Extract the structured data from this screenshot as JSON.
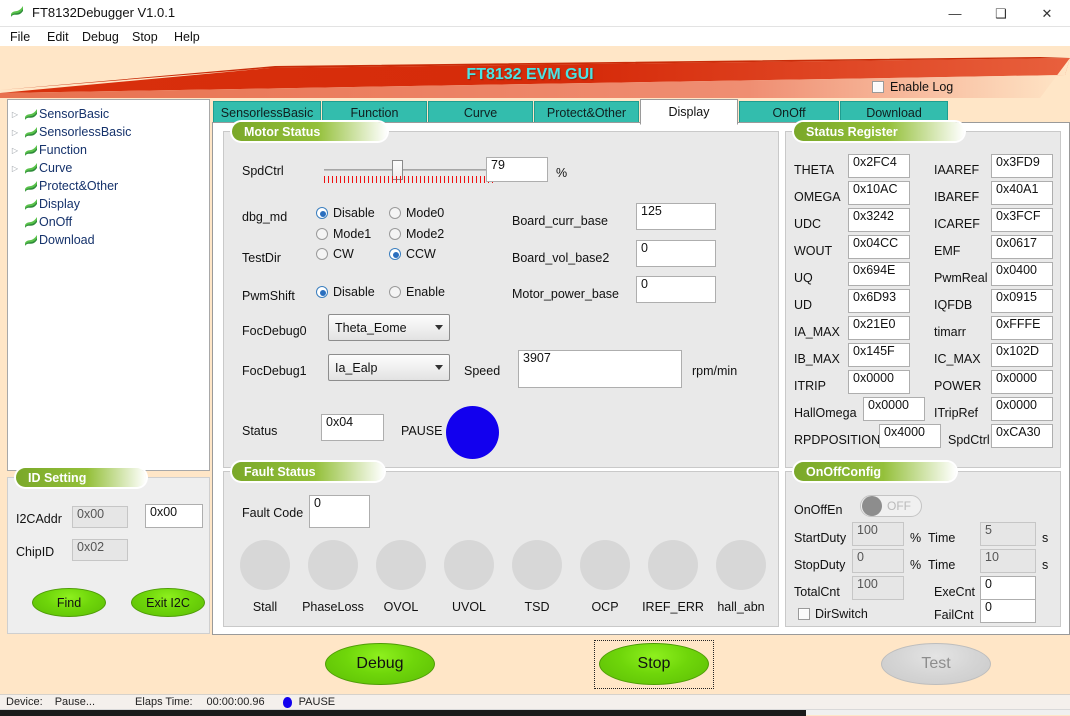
{
  "window": {
    "title": "FT8132Debugger V1.0.1",
    "app_icon": "flag-icon",
    "minimize": "—",
    "maximize": "❑",
    "close": "✕"
  },
  "menu": {
    "items": [
      {
        "label": "File"
      },
      {
        "label": "Edit"
      },
      {
        "label": "Debug"
      },
      {
        "label": "Stop"
      },
      {
        "label": "Help"
      }
    ]
  },
  "banner": {
    "title": "FT8132 EVM GUI",
    "enable_log_label": "Enable Log",
    "enable_log_checked": false,
    "shape_color": "#d62b0a",
    "title_color": "#4ae4e4",
    "background": "#ffe6c7"
  },
  "tree": {
    "items": [
      {
        "label": "SensorBasic",
        "expandable": true,
        "icon": "flag-icon"
      },
      {
        "label": "SensorlessBasic",
        "expandable": true,
        "icon": "flag-icon"
      },
      {
        "label": "Function",
        "expandable": true,
        "icon": "flag-icon"
      },
      {
        "label": "Curve",
        "expandable": true,
        "icon": "flag-icon"
      },
      {
        "label": "Protect&Other",
        "expandable": false,
        "icon": "flag-icon"
      },
      {
        "label": "Display",
        "expandable": false,
        "icon": "flag-icon"
      },
      {
        "label": "OnOff",
        "expandable": false,
        "icon": "flag-icon"
      },
      {
        "label": "Download",
        "expandable": false,
        "icon": "flag-icon"
      }
    ]
  },
  "id_setting": {
    "title": "ID Setting",
    "i2caddr_label": "I2CAddr",
    "i2caddr_value": "0x00",
    "i2caddr_input_value": "0x00",
    "chipid_label": "ChipID",
    "chipid_value": "0x02",
    "find_button": "Find",
    "exit_button": "Exit I2C"
  },
  "tabs": [
    {
      "label": "SensorlessBasic",
      "active": false
    },
    {
      "label": "Function",
      "active": false
    },
    {
      "label": "Curve",
      "active": false
    },
    {
      "label": "Protect&Other",
      "active": false
    },
    {
      "label": "Display",
      "active": true
    },
    {
      "label": "OnOff",
      "active": false
    },
    {
      "label": "Download",
      "active": false
    }
  ],
  "motor_status": {
    "title": "Motor Status",
    "spdctrl_label": "SpdCtrl",
    "spdctrl_value": "79",
    "spdctrl_unit": "%",
    "spdctrl_percent": 79,
    "dbg_md_label": "dbg_md",
    "dbg_md_options": [
      {
        "label": "Disable",
        "selected": true
      },
      {
        "label": "Mode0",
        "selected": false
      },
      {
        "label": "Mode1",
        "selected": false
      },
      {
        "label": "Mode2",
        "selected": false
      }
    ],
    "testdir_label": "TestDir",
    "testdir_options": [
      {
        "label": "CW",
        "selected": false
      },
      {
        "label": "CCW",
        "selected": true
      }
    ],
    "pwmshift_label": "PwmShift",
    "pwmshift_options": [
      {
        "label": "Disable",
        "selected": true
      },
      {
        "label": "Enable",
        "selected": false
      }
    ],
    "board_curr_base_label": "Board_curr_base",
    "board_curr_base_value": "125",
    "board_vol_base2_label": "Board_vol_base2",
    "board_vol_base2_value": "0",
    "motor_power_base_label": "Motor_power_base",
    "motor_power_base_value": "0",
    "focdebug0_label": "FocDebug0",
    "focdebug0_value": "Theta_Eome",
    "focdebug1_label": "FocDebug1",
    "focdebug1_value": "Ia_Ealp",
    "speed_label": "Speed",
    "speed_value": "3907",
    "speed_unit": "rpm/min",
    "status_label": "Status",
    "status_value": "0x04",
    "state_text": "PAUSE",
    "led_color": "#1200ee"
  },
  "status_register": {
    "title": "Status Register",
    "left": [
      {
        "label": "THETA",
        "value": "0x2FC4"
      },
      {
        "label": "OMEGA",
        "value": "0x10AC"
      },
      {
        "label": "UDC",
        "value": "0x3242"
      },
      {
        "label": "WOUT",
        "value": "0x04CC"
      },
      {
        "label": "UQ",
        "value": "0x694E"
      },
      {
        "label": "UD",
        "value": "0x6D93"
      },
      {
        "label": "IA_MAX",
        "value": "0x21E0"
      },
      {
        "label": "IB_MAX",
        "value": "0x145F"
      },
      {
        "label": "ITRIP",
        "value": "0x0000"
      },
      {
        "label": "HallOmega",
        "value": "0x0000"
      },
      {
        "label": "RPDPOSITION",
        "value": "0x4000"
      }
    ],
    "right": [
      {
        "label": "IAAREF",
        "value": "0x3FD9"
      },
      {
        "label": "IBAREF",
        "value": "0x40A1"
      },
      {
        "label": "ICAREF",
        "value": "0x3FCF"
      },
      {
        "label": "EMF",
        "value": "0x0617"
      },
      {
        "label": "PwmReal",
        "value": "0x0400"
      },
      {
        "label": "IQFDB",
        "value": "0x0915"
      },
      {
        "label": "timarr",
        "value": "0xFFFE"
      },
      {
        "label": "IC_MAX",
        "value": "0x102D"
      },
      {
        "label": "POWER",
        "value": "0x0000"
      },
      {
        "label": "ITripRef",
        "value": "0x0000"
      },
      {
        "label": "SpdCtrl",
        "value": "0xCA30"
      }
    ]
  },
  "fault_status": {
    "title": "Fault Status",
    "fault_code_label": "Fault Code",
    "fault_code_value": "0",
    "leds": [
      {
        "label": "Stall",
        "on": false
      },
      {
        "label": "PhaseLoss",
        "on": false
      },
      {
        "label": "OVOL",
        "on": false
      },
      {
        "label": "UVOL",
        "on": false
      },
      {
        "label": "TSD",
        "on": false
      },
      {
        "label": "OCP",
        "on": false
      },
      {
        "label": "IREF_ERR",
        "on": false
      },
      {
        "label": "hall_abn",
        "on": false
      }
    ]
  },
  "onoff_config": {
    "title": "OnOffConfig",
    "onoffen_label": "OnOffEn",
    "onoffen_state": "OFF",
    "startduty_label": "StartDuty",
    "startduty_value": "100",
    "startduty_unit": "%",
    "starttime_label": "Time",
    "starttime_value": "5",
    "starttime_unit": "s",
    "stopduty_label": "StopDuty",
    "stopduty_value": "0",
    "stopduty_unit": "%",
    "stoptime_label": "Time",
    "stoptime_value": "10",
    "stoptime_unit": "s",
    "totalcnt_label": "TotalCnt",
    "totalcnt_value": "100",
    "execnt_label": "ExeCnt",
    "execnt_value": "0",
    "dirswitch_label": "DirSwitch",
    "dirswitch_checked": false,
    "failcnt_label": "FailCnt",
    "failcnt_value": "0"
  },
  "actions": {
    "debug_button": "Debug",
    "stop_button": "Stop",
    "test_button": "Test",
    "test_enabled": false,
    "stop_focused": true
  },
  "statusbar": {
    "device_label": "Device:",
    "device_value": "Pause...",
    "elaps_label": "Elaps Time:",
    "elaps_value": "00:00:00.96",
    "state_text": "PAUSE",
    "led_color": "#1200ee"
  }
}
